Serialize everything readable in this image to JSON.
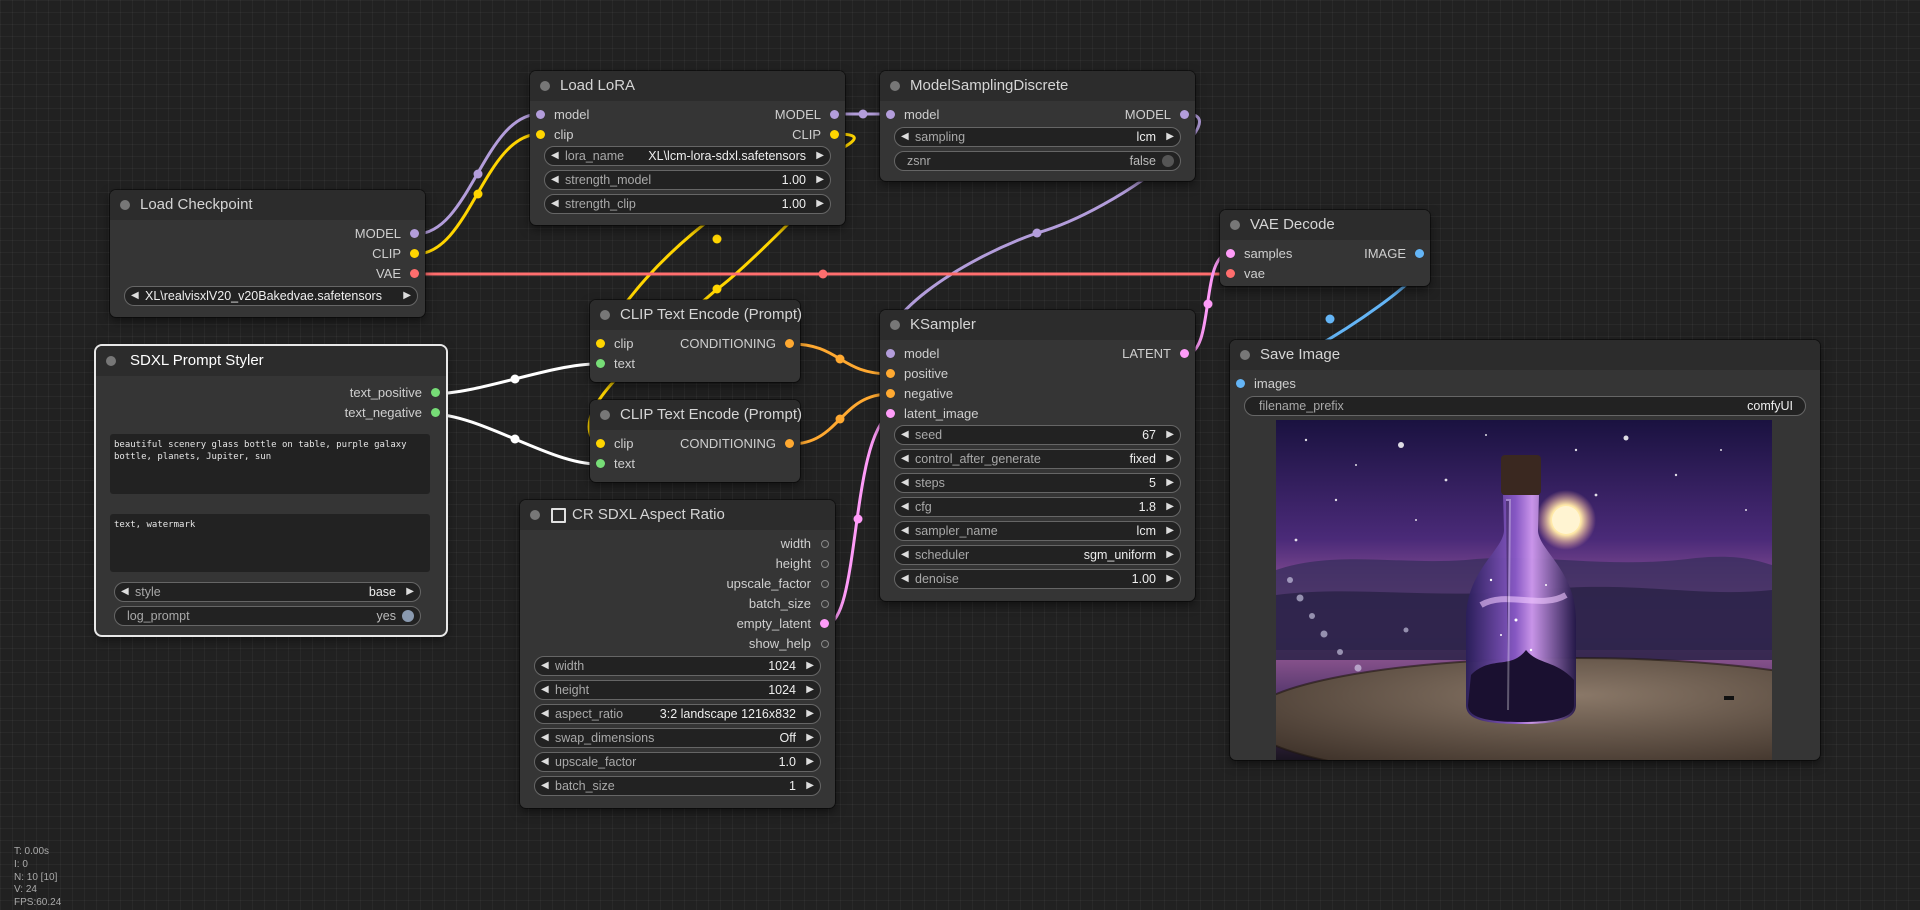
{
  "colors": {
    "model": "#b39ddb",
    "clip": "#ffd500",
    "vae": "#ff6e6e",
    "conditioning": "#ffa931",
    "latent": "#ff9cf9",
    "image": "#64b5f6",
    "string": "#77dd77",
    "int": "#888888"
  },
  "load_lora": {
    "title": "Load LoRA",
    "inputs": [
      "model",
      "clip"
    ],
    "outputs": [
      "MODEL",
      "CLIP"
    ],
    "widgets": [
      {
        "label": "lora_name",
        "value": "XL\\lcm-lora-sdxl.safetensors"
      },
      {
        "label": "strength_model",
        "value": "1.00"
      },
      {
        "label": "strength_clip",
        "value": "1.00"
      }
    ]
  },
  "model_sampling": {
    "title": "ModelSamplingDiscrete",
    "input": "model",
    "output": "MODEL",
    "sampling_label": "sampling",
    "sampling_value": "lcm",
    "zsnr_label": "zsnr",
    "zsnr_value": "false"
  },
  "load_checkpoint": {
    "title": "Load Checkpoint",
    "outputs": [
      "MODEL",
      "CLIP",
      "VAE"
    ],
    "ckpt_name": "XL\\realvisxlV20_v20Bakedvae.safetensors"
  },
  "vae_decode": {
    "title": "VAE Decode",
    "inputs": [
      "samples",
      "vae"
    ],
    "output": "IMAGE"
  },
  "clip_encode_1": {
    "title": "CLIP Text Encode (Prompt)",
    "inputs": [
      "clip",
      "text"
    ],
    "output": "CONDITIONING"
  },
  "clip_encode_2": {
    "title": "CLIP Text Encode (Prompt)",
    "inputs": [
      "clip",
      "text"
    ],
    "output": "CONDITIONING"
  },
  "prompt_styler": {
    "title": "SDXL Prompt Styler",
    "outputs": [
      "text_positive",
      "text_negative"
    ],
    "positive_text": "beautiful scenery glass bottle on table, purple galaxy bottle, planets, Jupiter, sun",
    "negative_text": "text, watermark",
    "style_label": "style",
    "style_value": "base",
    "log_label": "log_prompt",
    "log_value": "yes"
  },
  "ksampler": {
    "title": "KSampler",
    "inputs": [
      "model",
      "positive",
      "negative",
      "latent_image"
    ],
    "output": "LATENT",
    "widgets": [
      {
        "label": "seed",
        "value": "67"
      },
      {
        "label": "control_after_generate",
        "value": "fixed"
      },
      {
        "label": "steps",
        "value": "5"
      },
      {
        "label": "cfg",
        "value": "1.8"
      },
      {
        "label": "sampler_name",
        "value": "lcm"
      },
      {
        "label": "scheduler",
        "value": "sgm_uniform"
      },
      {
        "label": "denoise",
        "value": "1.00"
      }
    ]
  },
  "save_image": {
    "title": "Save Image",
    "input": "images",
    "prefix_label": "filename_prefix",
    "prefix_value": "comfyUI"
  },
  "aspect_ratio": {
    "title": "CR SDXL Aspect Ratio",
    "outputs": [
      "width",
      "height",
      "upscale_factor",
      "batch_size",
      "empty_latent",
      "show_help"
    ],
    "widgets": [
      {
        "label": "width",
        "value": "1024"
      },
      {
        "label": "height",
        "value": "1024"
      },
      {
        "label": "aspect_ratio",
        "value": "3:2 landscape 1216x832"
      },
      {
        "label": "swap_dimensions",
        "value": "Off"
      },
      {
        "label": "upscale_factor",
        "value": "1.0"
      },
      {
        "label": "batch_size",
        "value": "1"
      }
    ]
  },
  "stats": [
    "T: 0.00s",
    "I: 0",
    "N: 10 [10]",
    "V: 24",
    "FPS:60.24"
  ]
}
